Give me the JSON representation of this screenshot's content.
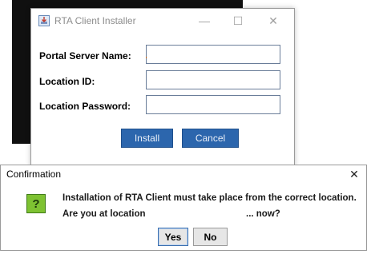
{
  "installer": {
    "title": "RTA Client Installer",
    "controls": {
      "minimize": "—",
      "maximize": "☐",
      "close": "✕"
    },
    "fields": [
      {
        "label": "Portal Server Name:",
        "value": ""
      },
      {
        "label": "Location ID:",
        "value": ""
      },
      {
        "label": "Location Password:",
        "value": ""
      }
    ],
    "install_label": "Install",
    "cancel_label": "Cancel"
  },
  "confirmation": {
    "title": "Confirmation",
    "close": "✕",
    "icon": "?",
    "message_line1": "Installation of RTA Client must take place from the correct location.",
    "message_line2a": "Are you at location",
    "message_line2b": "... now?",
    "yes_label": "Yes",
    "no_label": "No"
  },
  "colors": {
    "accent_button": "#2c66ad",
    "question_icon": "#7ec232"
  }
}
